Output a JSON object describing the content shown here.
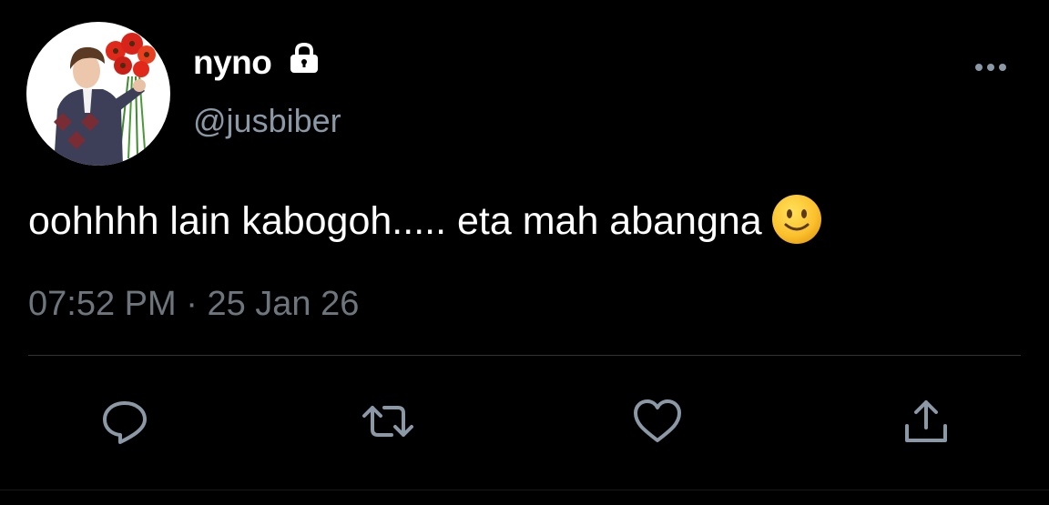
{
  "tweet": {
    "author": {
      "display_name": "nyno",
      "handle": "@jusbiber",
      "protected_icon": "lock-icon"
    },
    "text": "oohhhh lain kabogoh..... eta mah abangna",
    "emoji": "slightly-smiling-face-icon",
    "time": "07:52 PM",
    "separator": " · ",
    "date": "25 Jan 26"
  },
  "actions": [
    {
      "name": "reply",
      "icon": "reply-icon"
    },
    {
      "name": "retweet",
      "icon": "retweet-icon"
    },
    {
      "name": "like",
      "icon": "heart-icon"
    },
    {
      "name": "share",
      "icon": "share-icon"
    }
  ],
  "colors": {
    "background": "#000000",
    "text": "#ffffff",
    "secondary": "#8b98a5",
    "muted": "#6e767d",
    "divider": "#2f3336",
    "icon": "#8b98a5"
  }
}
